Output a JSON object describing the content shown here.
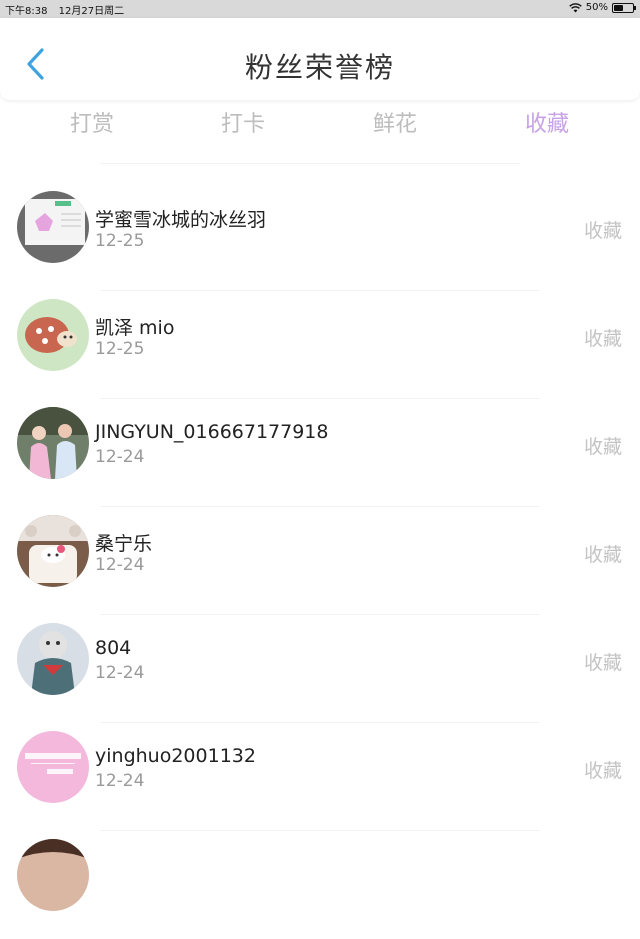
{
  "status_bar": {
    "time": "下午8:38",
    "date": "12月27日周二",
    "battery": "50%",
    "battery_level": 0.5
  },
  "header": {
    "title": "粉丝荣誉榜"
  },
  "tabs": [
    {
      "label": "打赏",
      "active": false
    },
    {
      "label": "打卡",
      "active": false
    },
    {
      "label": "鲜花",
      "active": false
    },
    {
      "label": "收藏",
      "active": true
    }
  ],
  "colors": {
    "accent": "#c7a2e6",
    "back_arrow": "#3fa3e0",
    "muted": "#bdbdbd"
  },
  "fans": [
    {
      "name": "学蜜雪冰城的冰丝羽",
      "date": "12-25",
      "action": "收藏"
    },
    {
      "name": "凯泽 mio",
      "date": "12-25",
      "action": "收藏"
    },
    {
      "name": "JINGYUN_016667177918",
      "date": "12-24",
      "action": "收藏"
    },
    {
      "name": "桑宁乐",
      "date": "12-24",
      "action": "收藏"
    },
    {
      "name": "804",
      "date": "12-24",
      "action": "收藏"
    },
    {
      "name": "yinghuo2001132",
      "date": "12-24",
      "action": "收藏"
    }
  ]
}
